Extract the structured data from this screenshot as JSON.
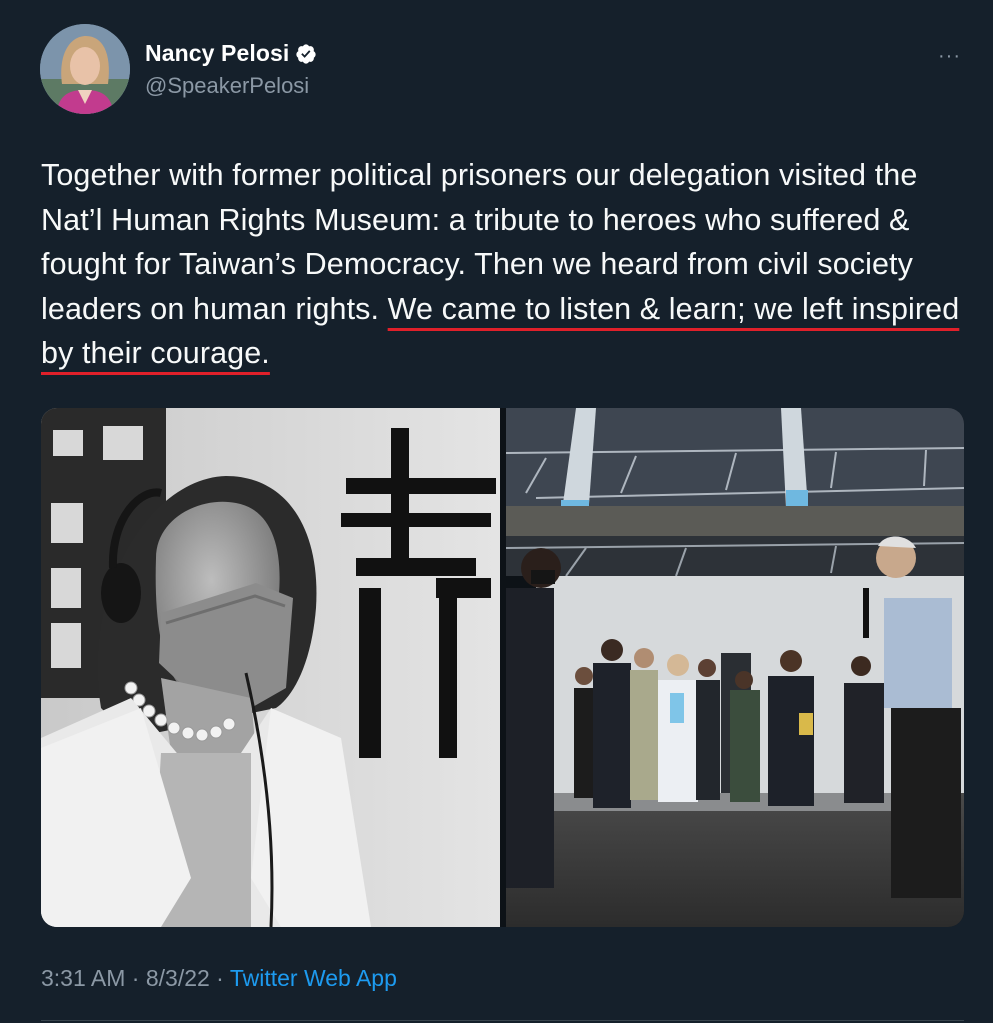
{
  "author": {
    "display_name": "Nancy Pelosi",
    "handle": "@SpeakerPelosi",
    "verified_icon": "verified-badge-icon",
    "avatar_icon": "profile-avatar"
  },
  "more_icon": "···",
  "tweet": {
    "text_before": "Together with former political prisoners our delegation visited the Nat’l Human Rights Museum: a tribute to heroes who suffered & fought for Taiwan’s Democracy. Then we heard from civil society leaders on human rights. ",
    "text_highlight": "We came to listen & learn; we left inspired by their courage.",
    "highlight_color": "#e0202a"
  },
  "media": {
    "photos": [
      "photo-pelosi-museum-bw",
      "photo-delegation-outdoor"
    ]
  },
  "footer": {
    "time": "3:31 AM",
    "sep1": " · ",
    "date": "8/3/22",
    "sep2": " · ",
    "source": "Twitter Web App",
    "link_color": "#1d9bf0"
  },
  "colors": {
    "background": "#15202b",
    "text": "#f7f9f9",
    "secondary": "#8b98a5"
  }
}
